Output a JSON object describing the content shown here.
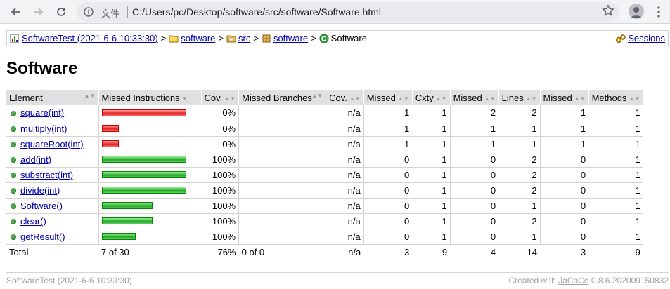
{
  "browser": {
    "addr_prefix": "文件",
    "url": "C:/Users/pc/Desktop/software/src/software/Software.html"
  },
  "breadcrumb": {
    "session": "SoftwareTest (2021-6-6 10:33:30)",
    "items": [
      "software",
      "src",
      "software"
    ],
    "current": "Software",
    "separator": ">",
    "sessions_link": "Sessions"
  },
  "page_title": "Software",
  "table": {
    "headers": [
      "Element",
      "Missed Instructions",
      "Cov.",
      "Missed Branches",
      "Cov.",
      "Missed",
      "Cxty",
      "Missed",
      "Lines",
      "Missed",
      "Methods"
    ],
    "rows": [
      {
        "name": "square(int)",
        "bar_color": "red",
        "bar_frac": 1.0,
        "cov": "0%",
        "branch_cov": "n/a",
        "m_cxty": "1",
        "cxty": "1",
        "m_lines": "2",
        "lines": "2",
        "m_methods": "1",
        "methods": "1"
      },
      {
        "name": "multiply(int)",
        "bar_color": "red",
        "bar_frac": 0.2,
        "cov": "0%",
        "branch_cov": "n/a",
        "m_cxty": "1",
        "cxty": "1",
        "m_lines": "1",
        "lines": "1",
        "m_methods": "1",
        "methods": "1"
      },
      {
        "name": "squareRoot(int)",
        "bar_color": "red",
        "bar_frac": 0.2,
        "cov": "0%",
        "branch_cov": "n/a",
        "m_cxty": "1",
        "cxty": "1",
        "m_lines": "1",
        "lines": "1",
        "m_methods": "1",
        "methods": "1"
      },
      {
        "name": "add(int)",
        "bar_color": "green",
        "bar_frac": 1.0,
        "cov": "100%",
        "branch_cov": "n/a",
        "m_cxty": "0",
        "cxty": "1",
        "m_lines": "0",
        "lines": "2",
        "m_methods": "0",
        "methods": "1"
      },
      {
        "name": "substract(int)",
        "bar_color": "green",
        "bar_frac": 1.0,
        "cov": "100%",
        "branch_cov": "n/a",
        "m_cxty": "0",
        "cxty": "1",
        "m_lines": "0",
        "lines": "2",
        "m_methods": "0",
        "methods": "1"
      },
      {
        "name": "divide(int)",
        "bar_color": "green",
        "bar_frac": 1.0,
        "cov": "100%",
        "branch_cov": "n/a",
        "m_cxty": "0",
        "cxty": "1",
        "m_lines": "0",
        "lines": "2",
        "m_methods": "0",
        "methods": "1"
      },
      {
        "name": "Software()",
        "bar_color": "green",
        "bar_frac": 0.6,
        "cov": "100%",
        "branch_cov": "n/a",
        "m_cxty": "0",
        "cxty": "1",
        "m_lines": "0",
        "lines": "1",
        "m_methods": "0",
        "methods": "1"
      },
      {
        "name": "clear()",
        "bar_color": "green",
        "bar_frac": 0.6,
        "cov": "100%",
        "branch_cov": "n/a",
        "m_cxty": "0",
        "cxty": "1",
        "m_lines": "0",
        "lines": "2",
        "m_methods": "0",
        "methods": "1"
      },
      {
        "name": "getResult()",
        "bar_color": "green",
        "bar_frac": 0.4,
        "cov": "100%",
        "branch_cov": "n/a",
        "m_cxty": "0",
        "cxty": "1",
        "m_lines": "0",
        "lines": "1",
        "m_methods": "0",
        "methods": "1"
      }
    ],
    "total": {
      "label": "Total",
      "instr": "7 of 30",
      "cov": "76%",
      "branches": "0 of 0",
      "branch_cov": "n/a",
      "m_cxty": "3",
      "cxty": "9",
      "m_lines": "4",
      "lines": "14",
      "m_methods": "3",
      "methods": "9"
    }
  },
  "footer": {
    "left": "SoftwareTest (2021-6-6 10:33:30)",
    "created_with": "Created with",
    "jacoco_link": "JaCoCo",
    "version": "0.8.6.202009150832"
  },
  "colors": {
    "link": "#0000aa",
    "missed_bar": "#dd2222",
    "covered_bar": "#22aa22",
    "header_bg": "#e0e0e0"
  }
}
